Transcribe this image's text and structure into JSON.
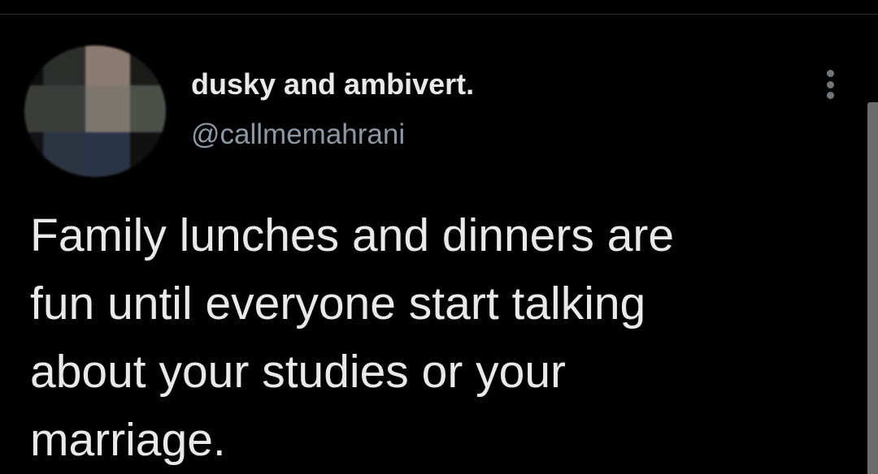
{
  "tweet": {
    "author": {
      "display_name": "dusky and ambivert.",
      "handle": "@callmemahrani",
      "avatar_blur_colors": [
        "#0d0d0d",
        "#2b2f2c",
        "#8c7b70",
        "#1b1c1a",
        "#3b3d38",
        "#3a3e3b",
        "#7d766f",
        "#4b5049",
        "#111214",
        "#2c3442",
        "#2a3447",
        "#101010"
      ]
    },
    "text_lines": [
      "Family lunches and dinners are",
      "fun until everyone start talking",
      "about your studies or your",
      "marriage."
    ],
    "more_icon": "more-vertical-icon"
  },
  "theme": {
    "background": "#000000",
    "text": "#e7e9ea",
    "secondary_text": "#8b98a5"
  }
}
